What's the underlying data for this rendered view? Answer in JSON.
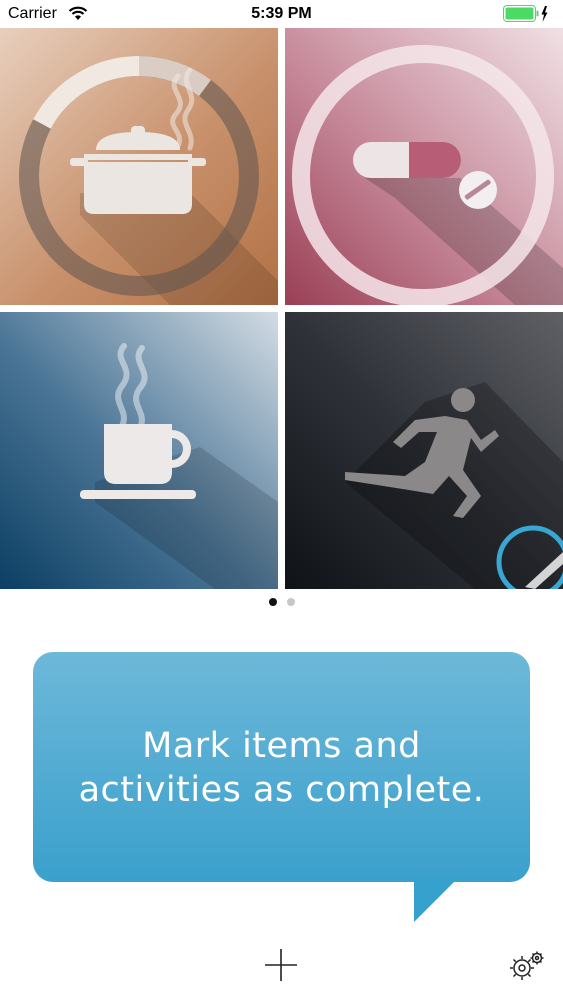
{
  "status_bar": {
    "carrier": "Carrier",
    "time": "5:39 PM",
    "icons": [
      "wifi-icon",
      "battery-icon",
      "charging-icon"
    ],
    "battery_color": "#4cd964"
  },
  "tiles": [
    {
      "name": "cooking",
      "icon": "cooking-pot-icon",
      "ring_color": "#6e6e6e"
    },
    {
      "name": "medication",
      "icon": "pill-icon",
      "ring_color": "#f4e6ea"
    },
    {
      "name": "coffee",
      "icon": "coffee-cup-icon"
    },
    {
      "name": "exercise",
      "icon": "running-person-icon",
      "indicator_color": "#3aa7d2"
    }
  ],
  "pager": {
    "pages": 2,
    "current": 1
  },
  "tooltip": {
    "line1": "Mark items and",
    "line2": "activities as complete.",
    "color": "#3fa4d0"
  },
  "toolbar": {
    "add_icon": "plus-icon",
    "settings_icon": "gear-icon"
  }
}
